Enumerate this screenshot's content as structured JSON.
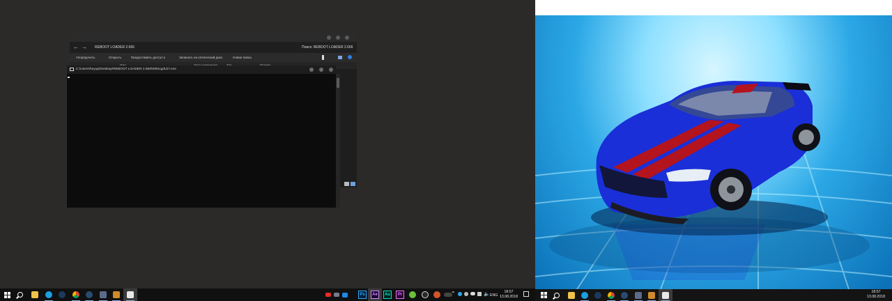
{
  "explorer": {
    "address": "REBOOT LOADER 2.666",
    "search_label": "Поиск: REBOOT LOADER 2.666",
    "ribbon": [
      "Упорядочить",
      "Открыть",
      "Предоставить доступ к",
      "Записать на оптический диск",
      "Новая папка"
    ],
    "columns": [
      "Имя",
      "Дата изменения",
      "Тип",
      "Размер"
    ]
  },
  "console": {
    "title": "C:\\Users\\heyup\\Desktop\\REBOOT LOADER 2.666\\W92cgdLb7.exe"
  },
  "taskbar_left": {
    "lang": "ENG",
    "time": "18:57",
    "date": "13.08.2018",
    "adobe_apps": [
      "Ps",
      "Ae",
      "Au",
      "Pr"
    ]
  },
  "taskbar_right": {
    "time": "18:57",
    "date": "13.08.2018"
  },
  "colors": {
    "car_body": "#1a2fd8",
    "car_stripe": "#b3141e",
    "scene_sky": "#2ca8e6"
  },
  "icons": {
    "start": "windows-start-icon",
    "search": "search-icon",
    "apps": [
      "skype-icon",
      "steam-icon",
      "chrome-icon",
      "steam-icon",
      "window-icon",
      "game-icon",
      "console-icon"
    ]
  }
}
